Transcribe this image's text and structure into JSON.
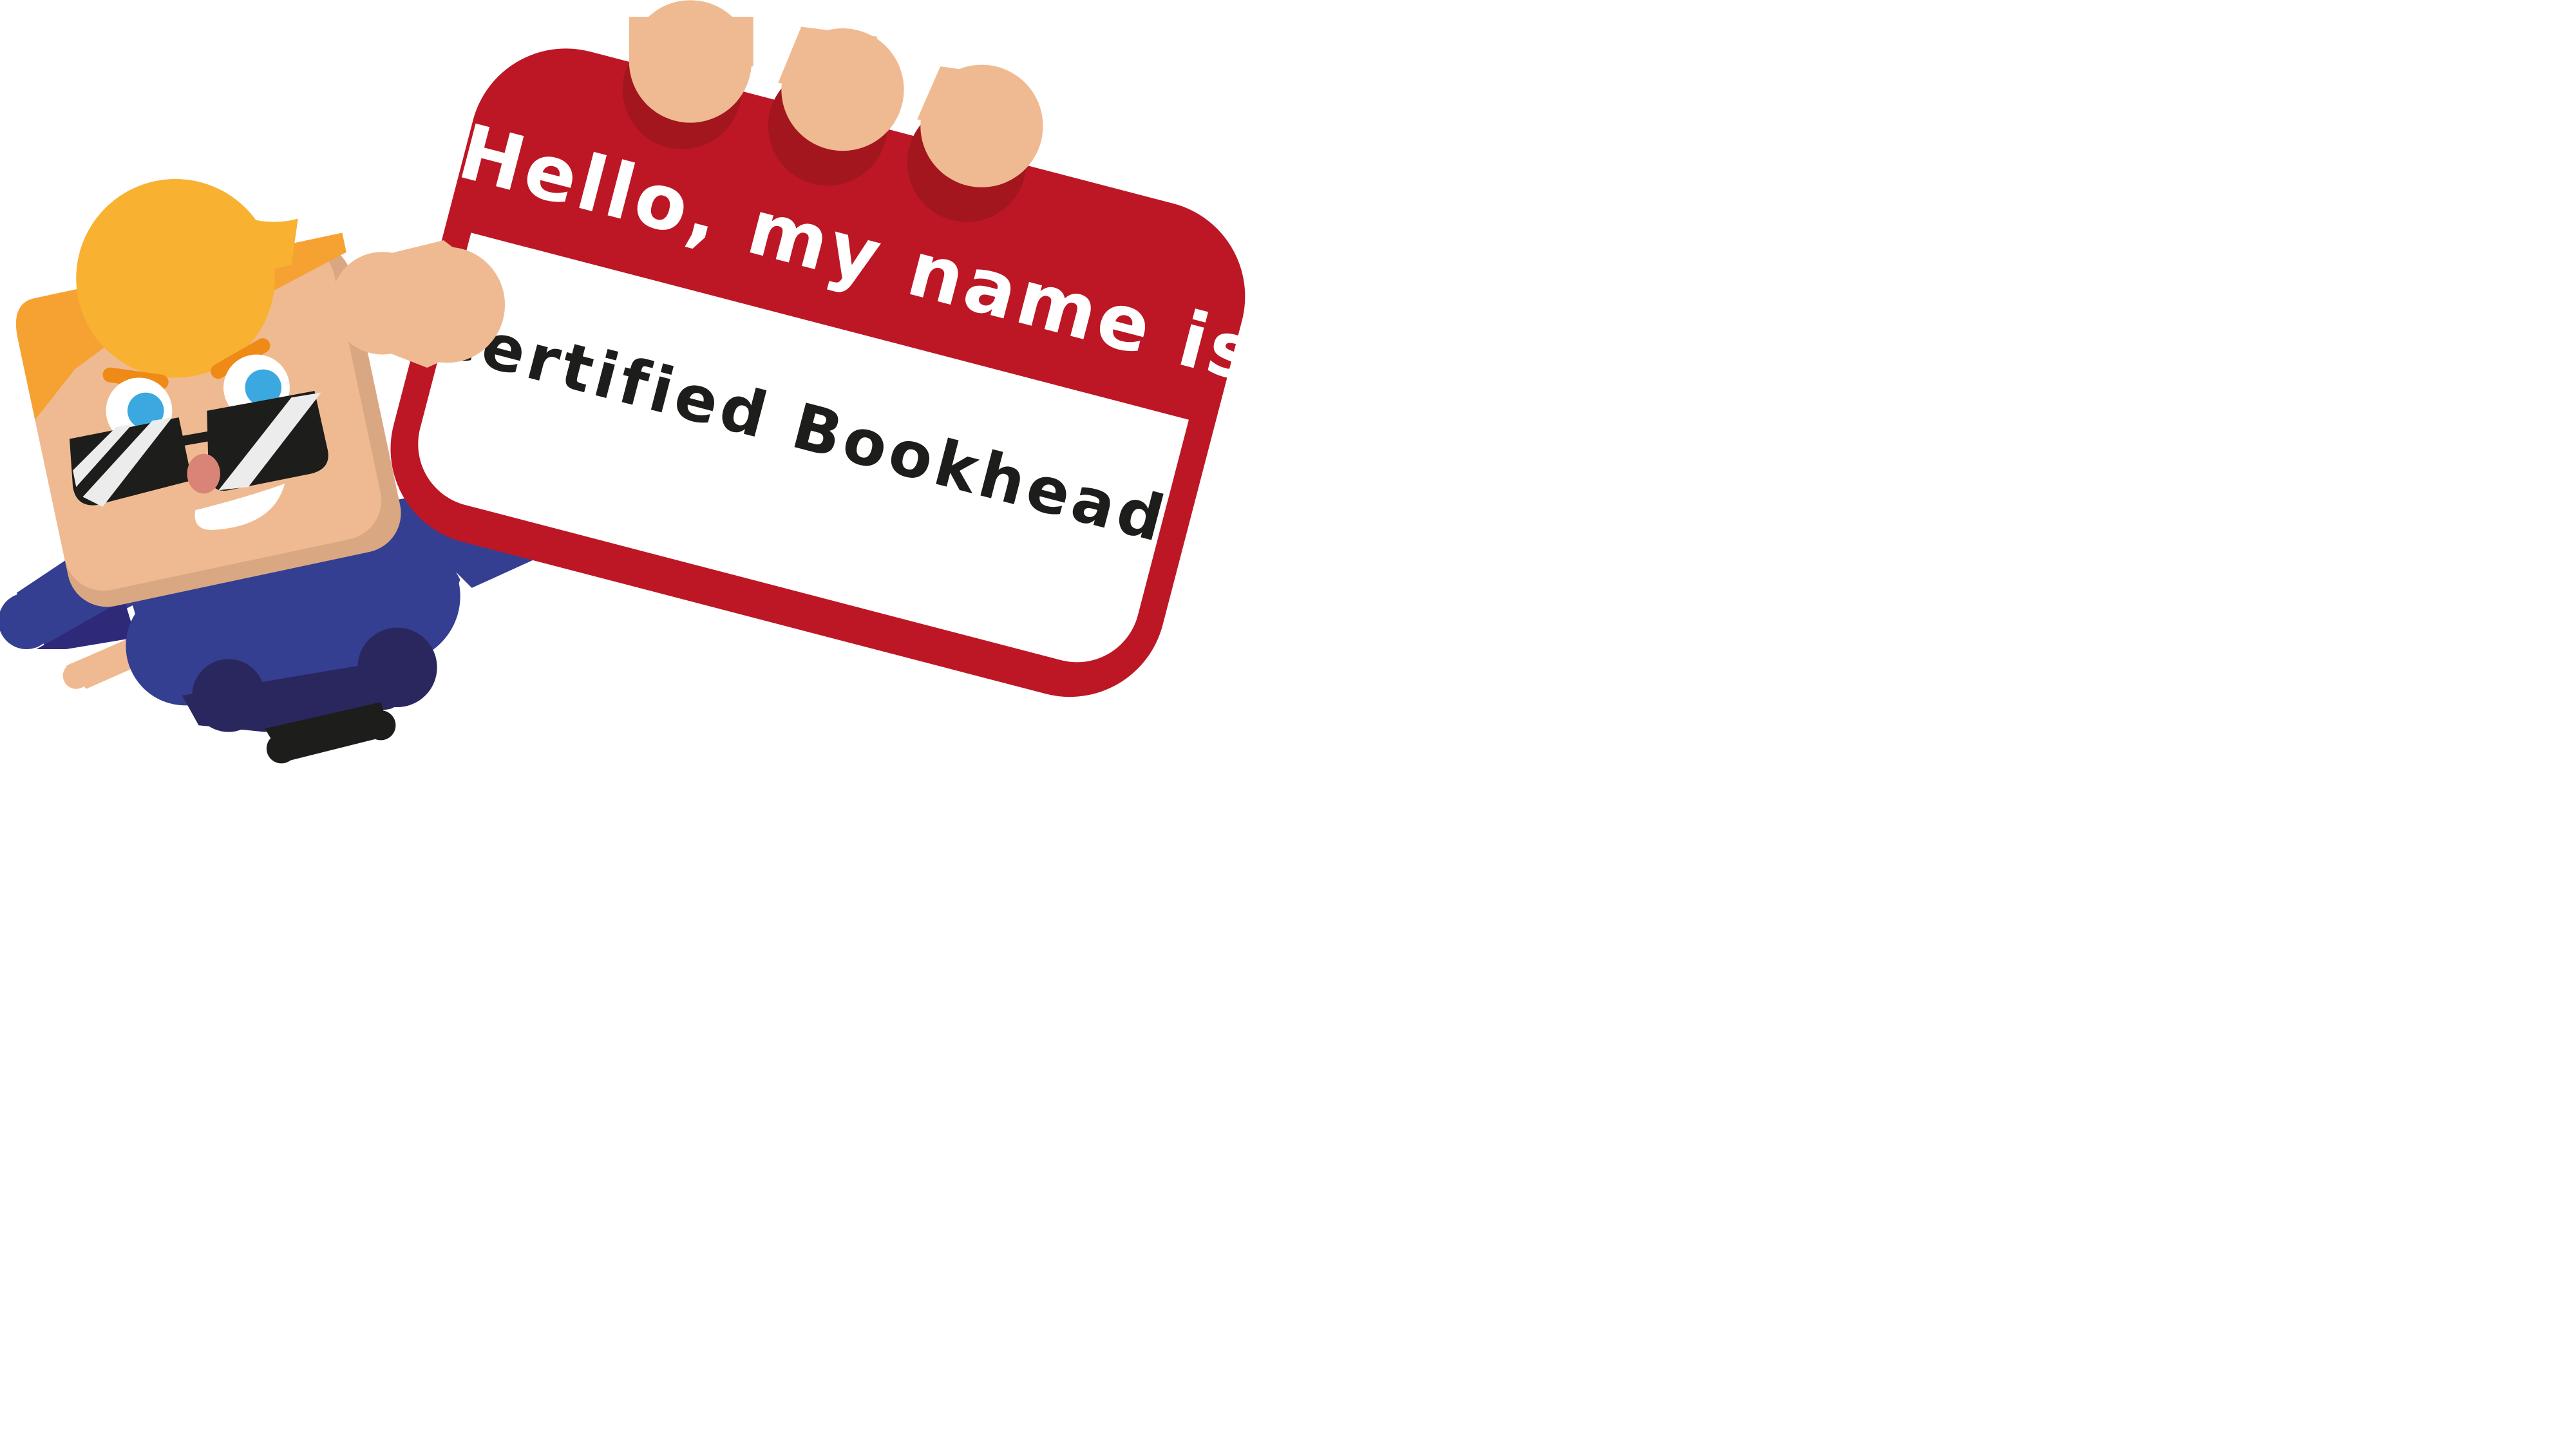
{
  "name_tag": {
    "header": "Hello, my name is",
    "name": "Certified Bookhead"
  },
  "colors": {
    "tag_red": "#bd1725",
    "tag_dark_red": "#a3161e",
    "tag_white": "#ffffff",
    "skin": "#efba91",
    "skin_shade": "#d9a882",
    "hair_yellow": "#f8b131",
    "hair_orange": "#f6a233",
    "shirt_blue": "#343f91",
    "shirt_dark": "#29275e",
    "shoe_black": "#1d1d1b",
    "sunglasses": "#1d1d1b",
    "eye_blue": "#3ba9e0",
    "eyebrow_orange": "#ef8a17",
    "nose_pink": "#d98477"
  },
  "icons": {
    "character": "cartoon-person-with-sunglasses",
    "tag": "name-tag-sticker"
  }
}
